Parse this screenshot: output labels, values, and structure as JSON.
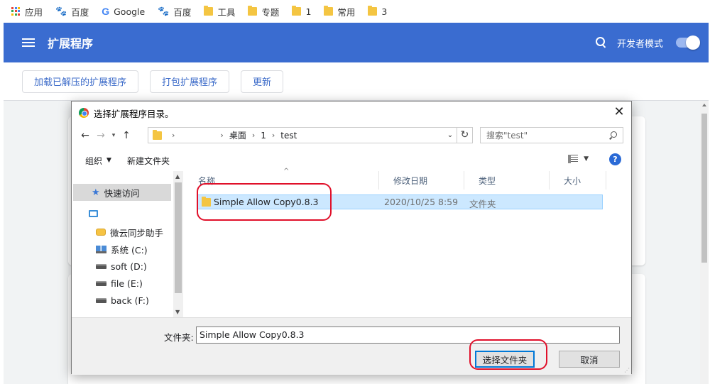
{
  "bookmarks": [
    {
      "label": "应用",
      "icon": "apps-grid-icon"
    },
    {
      "label": "百度",
      "icon": "baidu-paw-icon"
    },
    {
      "label": "Google",
      "icon": "google-g-icon"
    },
    {
      "label": "百度",
      "icon": "baidu-paw-icon"
    },
    {
      "label": "工具",
      "icon": "folder-icon"
    },
    {
      "label": "专题",
      "icon": "folder-icon"
    },
    {
      "label": "1",
      "icon": "folder-icon"
    },
    {
      "label": "常用",
      "icon": "folder-icon"
    },
    {
      "label": "3",
      "icon": "folder-icon"
    }
  ],
  "header": {
    "title": "扩展程序",
    "dev_mode_label": "开发者模式",
    "dev_mode_on": true,
    "color": "#3a6cd0"
  },
  "actions": {
    "load_unpacked": "加载已解压的扩展程序",
    "pack": "打包扩展程序",
    "update": "更新"
  },
  "dialog": {
    "title": "选择扩展程序目录。",
    "breadcrumb": [
      "",
      "桌面",
      "1",
      "test"
    ],
    "search_placeholder": "搜索\"test\"",
    "toolbar": {
      "organize": "组织",
      "new_folder": "新建文件夹"
    },
    "nav_items": [
      {
        "label": "快速访问",
        "icon": "star-icon"
      },
      {
        "label": "",
        "icon": "computer-icon"
      },
      {
        "label": "微云同步助手",
        "icon": "cloud-folder-icon"
      },
      {
        "label": "系统 (C:)",
        "icon": "windows-drive-icon"
      },
      {
        "label": "soft (D:)",
        "icon": "drive-icon"
      },
      {
        "label": "file (E:)",
        "icon": "drive-icon"
      },
      {
        "label": "back (F:)",
        "icon": "drive-icon"
      }
    ],
    "columns": {
      "name": "名称",
      "modified": "修改日期",
      "type": "类型",
      "size": "大小"
    },
    "files": [
      {
        "name": "Simple Allow Copy0.8.3",
        "modified": "2020/10/25 8:59",
        "type": "文件夹",
        "size": ""
      }
    ],
    "folder_label": "文件夹:",
    "folder_value": "Simple Allow Copy0.8.3",
    "select_button": "选择文件夹",
    "cancel_button": "取消"
  },
  "colors": {
    "highlight": "#e0102a",
    "selection": "#cce8ff",
    "accent": "#0078d7"
  }
}
